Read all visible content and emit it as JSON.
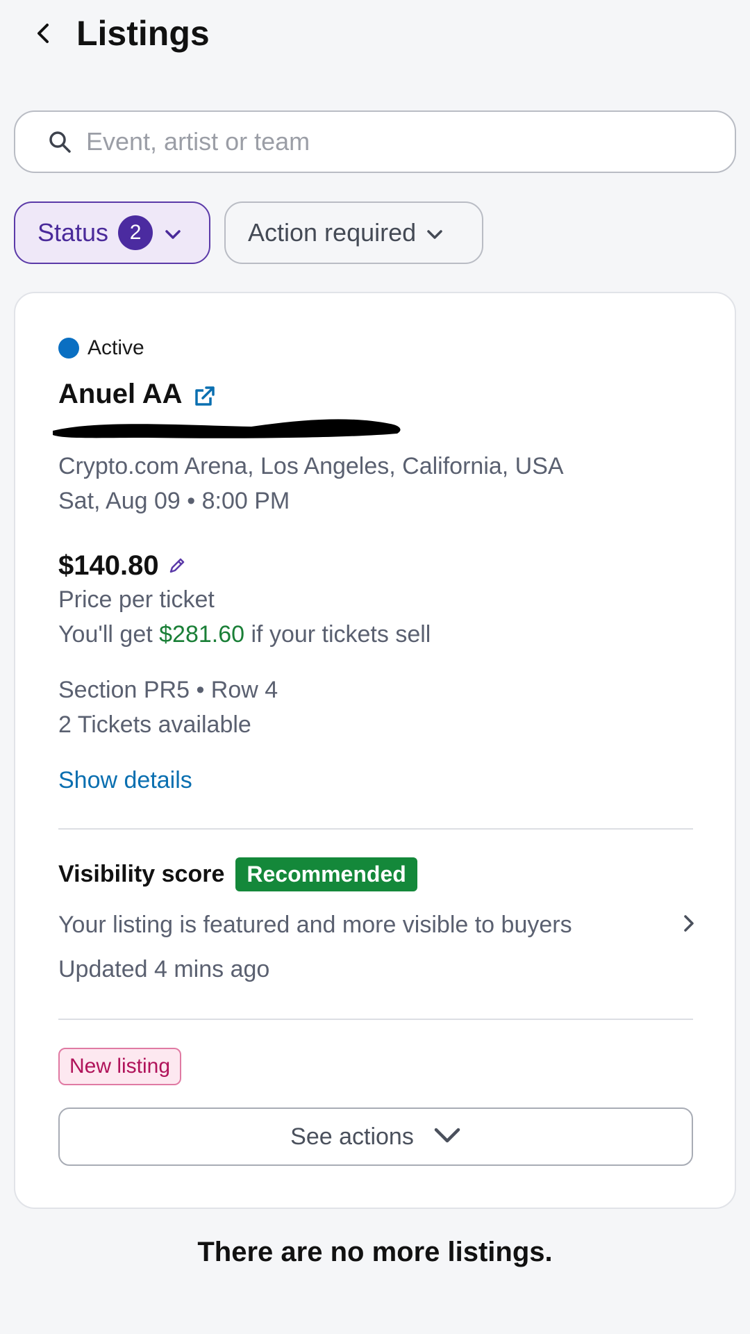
{
  "header": {
    "title": "Listings"
  },
  "search": {
    "placeholder": "Event, artist or team",
    "value": ""
  },
  "filters": {
    "status_label": "Status",
    "status_count": "2",
    "action_label": "Action required"
  },
  "listing": {
    "status": "Active",
    "event_name": "Anuel AA",
    "venue": "Crypto.com Arena, Los Angeles, California, USA",
    "datetime": "Sat, Aug 09 • 8:00 PM",
    "price": "$140.80",
    "price_label": "Price per ticket",
    "payout_prefix": "You'll get ",
    "payout_amount": "$281.60",
    "payout_suffix": " if your tickets sell",
    "section": "Section PR5 • Row 4",
    "tickets": "2 Tickets available",
    "show_details": "Show details",
    "visibility_label": "Visibility score",
    "visibility_badge": "Recommended",
    "visibility_desc": "Your listing is featured and more visible to buyers",
    "updated": "Updated 4 mins ago",
    "new_badge": "New listing",
    "see_actions": "See actions"
  },
  "footer": {
    "message": "There are no more listings."
  },
  "colors": {
    "accent_purple": "#4b2ba0",
    "status_blue": "#0a6fc2",
    "link_blue": "#0a6fb0",
    "payout_green": "#1a7f37",
    "recommended_green": "#14883a",
    "new_listing_pink": "#b0135a"
  },
  "icons": [
    "back-arrow-icon",
    "search-icon",
    "chevron-down-icon",
    "external-link-icon",
    "pencil-icon",
    "chevron-right-icon"
  ]
}
